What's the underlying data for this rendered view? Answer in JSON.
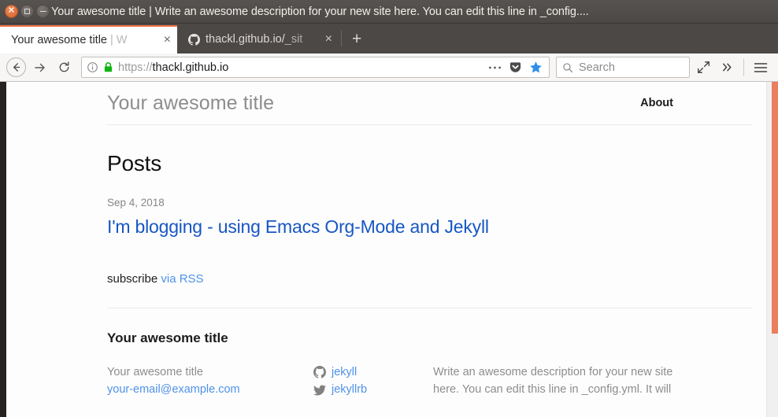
{
  "window": {
    "title": "Your awesome title | Write an awesome description for your new site here. You can edit this line in _config....",
    "close_label": "✕",
    "maximize_label": "",
    "minimize_label": ""
  },
  "browser": {
    "tabs": [
      {
        "label_main": "Your awesome title",
        "label_dim": " | W",
        "close_label": "×",
        "active": true,
        "favicon": "none"
      },
      {
        "label_main": "thackl.github.io/",
        "label_dim": "_sit",
        "close_label": "×",
        "active": false,
        "favicon": "github-icon"
      }
    ],
    "new_tab_label": "+",
    "nav": {
      "back_icon": "back-arrow-icon",
      "forward_icon": "forward-arrow-icon",
      "reload_icon": "reload-icon",
      "info_icon": "page-info-icon",
      "lock_icon": "lock-icon",
      "url_scheme": "https://",
      "url_host": "thackl.github.io",
      "page_actions_icon": "ellipsis-icon",
      "pocket_icon": "pocket-icon",
      "bookmark_icon": "star-icon",
      "bookmark_color": "#2f8fe8"
    },
    "search": {
      "icon": "search-icon",
      "placeholder": "Search"
    },
    "right_controls": {
      "expand_icon": "expand-arrows-icon",
      "overflow_icon": "double-chevron-right-icon",
      "menu_icon": "hamburger-menu-icon"
    }
  },
  "site": {
    "header": {
      "title": "Your awesome title",
      "nav_about": "About"
    },
    "main": {
      "heading": "Posts",
      "posts": [
        {
          "date": "Sep 4, 2018",
          "title": "I'm blogging - using Emacs Org-Mode and Jekyll"
        }
      ],
      "subscribe_text": "subscribe",
      "subscribe_link": "via RSS"
    },
    "footer": {
      "heading": "Your awesome title",
      "contact": {
        "name": "Your awesome title",
        "email": "your-email@example.com"
      },
      "social": [
        {
          "icon": "github-icon",
          "label": "jekyll"
        },
        {
          "icon": "twitter-icon",
          "label": "jekyllrb"
        }
      ],
      "description": "Write an awesome description for your new site here. You can edit this line in _config.yml. It will"
    }
  }
}
